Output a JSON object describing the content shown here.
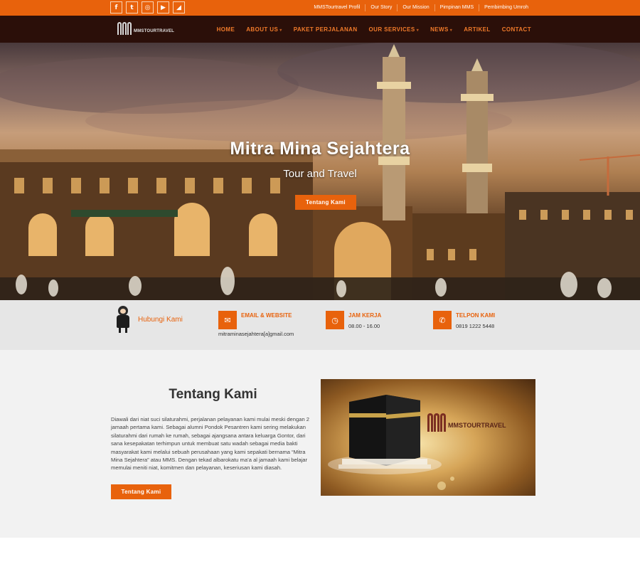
{
  "topbar": {
    "social": [
      {
        "icon": "facebook-icon",
        "glyph": "f"
      },
      {
        "icon": "twitter-icon",
        "glyph": "t"
      },
      {
        "icon": "instagram-icon",
        "glyph": "◎"
      },
      {
        "icon": "youtube-icon",
        "glyph": "▶"
      },
      {
        "icon": "rss-icon",
        "glyph": "◢"
      }
    ],
    "links": [
      "MMSTourtravel Profil",
      "Our Story",
      "Our Mission",
      "Pimpinan MMS",
      "Pembimbing Umroh"
    ]
  },
  "navbar": {
    "logo_text": "MMSTOURTRAVEL",
    "items": [
      "HOME",
      "ABOUT US",
      "PAKET PERJALANAN",
      "OUR SERVICES",
      "NEWS",
      "ARTIKEL",
      "CONTACT"
    ]
  },
  "hero": {
    "title": "Mitra Mina Sejahtera",
    "subtitle": "Tour and Travel",
    "button": "Tentang Kami"
  },
  "contact": {
    "hubungi": "Hubungi Kami",
    "email": {
      "title": "EMAIL & WEBSITE",
      "value": "mitraminasejahtera[a]gmail.com",
      "icon": "envelope-icon"
    },
    "hours": {
      "title": "JAM KERJA",
      "value": "08.00 - 16.00",
      "icon": "clock-icon"
    },
    "phone": {
      "title": "TELPON KAMI",
      "value": "0819 1222 5448",
      "icon": "phone-icon"
    }
  },
  "about": {
    "heading": "Tentang Kami",
    "body": "Diawali dari niat suci silaturahmi, perjalanan pelayanan kami mulai meski dengan 2 jamaah pertama kami. Sebagai alumni Pondok Pesantren kami sering melakukan silaturahmi dari rumah ke rumah, sebagai ajangsana antara keluarga Gontor, dari sana kesepakatan terhimpun untuk membuat satu wadah sebagai media bakti masyarakat kami melalui sebuah perusahaan yang kami sepakati bernama “Mitra Mina Sejahtera” atau MMS. Dengan tekad albarokatu ma’a al jamaah kami belajar memulai meniti niat, komitmen dan pelayanan, keseriusan kami diasah.",
    "button": "Tentang Kami",
    "image_brand": "MMSTOURTRAVEL"
  },
  "colors": {
    "accent": "#e8620c",
    "nav_bg": "#2b0f09",
    "strip_bg": "#e6e6e6"
  }
}
